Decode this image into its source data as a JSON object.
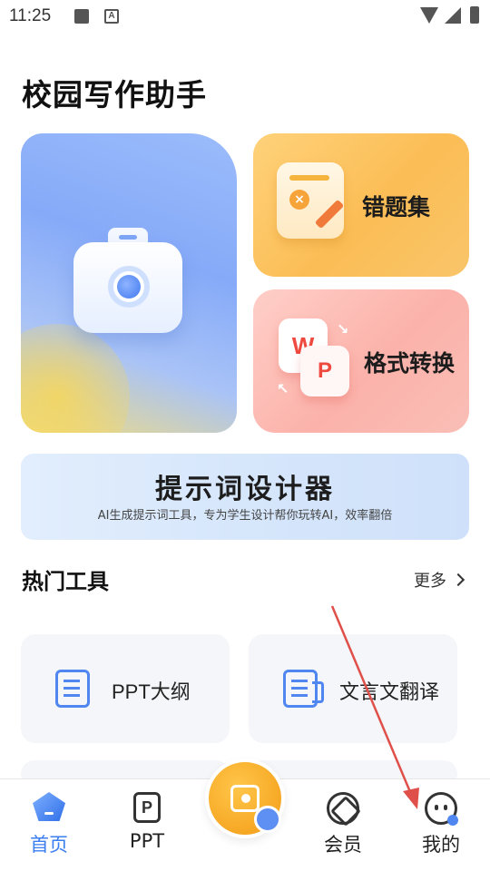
{
  "status_bar": {
    "time": "11:25",
    "keyboard_badge": "A"
  },
  "app": {
    "title": "校园写作助手"
  },
  "features": {
    "camera": {
      "icon": "camera-icon"
    },
    "mistakes": {
      "label": "错题集",
      "icon": "wrong-question-book-icon"
    },
    "convert": {
      "label": "格式转换",
      "icon": "word-ppt-convert-icon",
      "letter_w": "W",
      "letter_p": "P"
    }
  },
  "banner": {
    "title": "提示词设计器",
    "subtitle": "AI生成提示词工具，专为学生设计帮你玩转AI，效率翻倍"
  },
  "hot_tools": {
    "title": "热门工具",
    "more": "更多",
    "items": [
      {
        "label": "PPT大纲",
        "icon": "document-lines-icon"
      },
      {
        "label": "文言文翻译",
        "icon": "translate-doc-icon"
      }
    ]
  },
  "bottom_nav": {
    "items": [
      {
        "label": "首页",
        "icon": "home-icon",
        "active": true
      },
      {
        "label": "PPT",
        "icon": "ppt-icon",
        "active": false
      },
      {
        "label": "会员",
        "icon": "vip-icon",
        "active": false
      },
      {
        "label": "我的",
        "icon": "profile-face-icon",
        "active": false
      }
    ],
    "center_button": {
      "icon": "scan-camera-icon"
    },
    "ppt_glyph": "P"
  },
  "colors": {
    "accent": "#3b7ef0",
    "annotation_arrow": "#e0504a"
  }
}
